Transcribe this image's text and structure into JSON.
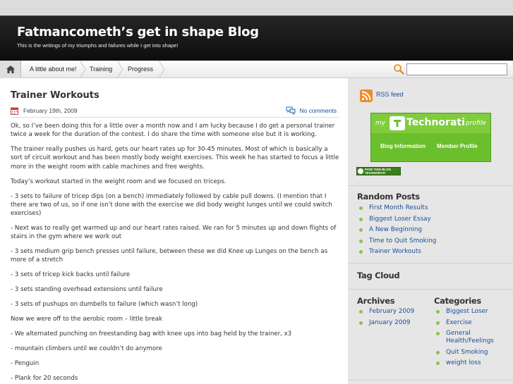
{
  "header": {
    "title": "Fatmancometh’s get in shape Blog",
    "subtitle": "This is the writings of my triumphs and failures while I get into shape!"
  },
  "nav": {
    "home_icon": "home-icon",
    "items": [
      {
        "label": "A little about me!"
      },
      {
        "label": "Training"
      },
      {
        "label": "Progress"
      }
    ],
    "search_placeholder": ""
  },
  "post": {
    "title": "Trainer Workouts",
    "date": "February 19th, 2009",
    "comments": "No comments",
    "paragraphs": [
      "Ok, so I’ve been doing this for a little over a month now and I am lucky because I do get a personal trainer twice a week for the duration of the contest.  I do share the time with someone else but it is working.",
      "The trainer really pushes us hard, gets our heart rates up for 30-45 minutes.  Most of which is basically a sort of circuit workout and has been mostly body weight exercises.  This week he has started to focus a little more in the weight room with cable machines and free weights.",
      "Today’s workout started in the weight room and we focused on triceps.",
      "- 3 sets to failure of tricep dips (on a bench) immediately followed by cable pull downs.  (I mention that I there are two of us, so if one isn’t done with the exercise we did body weight lunges until we could switch exercises)",
      "- Next was to really get warmed up and our heart rates raised.  We ran for 5 minutes up and down flights of stairs in the gym where we work out",
      "- 3 sets medium grip bench presses until failure, between these we did Knee up Lunges on the bench as more of a stretch",
      "- 3 sets of tricep kick backs until failure",
      "- 3 sets standing overhead extensions until failure",
      "- 3 sets of pushups on dumbells to failure (which wasn’t long)",
      "Now we were off to the aerobic room – little break",
      "- We alternated punching on freestanding bag with knee ups into bag held by the trainer, x3",
      "- mountain climbers until we couldn’t do anymore",
      "- Penguin",
      "- Plank for 20 seconds"
    ]
  },
  "sidebar": {
    "rss_label": "RSS feed",
    "technorati": {
      "my": "my",
      "name": "Technorati",
      "profile": "profile",
      "blog_info": "Blog Information",
      "member_profile": "Member Profile"
    },
    "fave": {
      "line1": "FAVE THIS BLOG",
      "line2": "TECHNORATI"
    },
    "random_posts": {
      "heading": "Random Posts",
      "items": [
        "First Month Results",
        "Biggest Loser Essay",
        "A New Beginning",
        "Time to Quit Smoking",
        "Trainer Workouts"
      ]
    },
    "tag_cloud": {
      "heading": "Tag Cloud"
    },
    "archives": {
      "heading": "Archives",
      "items": [
        "February 2009",
        "January 2009"
      ]
    },
    "categories": {
      "heading": "Categories",
      "items": [
        "Biggest Loser",
        "Exercise",
        "General Health/Feelings",
        "Quit Smoking",
        "weight loss"
      ]
    }
  },
  "colors": {
    "header_bg": "#1a1a1a",
    "link": "#1a4d99",
    "sidebar_bg": "#e6e6e6",
    "bullet": "#8ac249",
    "technorati_green": "#6bbf2c"
  }
}
